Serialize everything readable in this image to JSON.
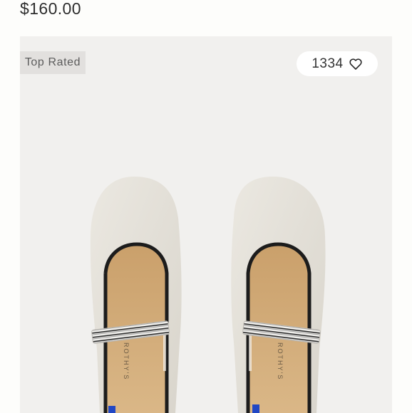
{
  "product": {
    "price": "$160.00"
  },
  "card": {
    "badge": "Top Rated",
    "favorites": {
      "count": "1334",
      "icon": "heart-icon"
    },
    "image": {
      "subject": "pair of white knit Mary Jane flats with black trim and striped strap",
      "insole_brand": "ROTHY'S"
    }
  },
  "colors": {
    "card_background": "#f1f0ee",
    "badge_background": "#e2e0de",
    "shoe_knit": "#e5e2da",
    "insole": "#d4ad78",
    "trim": "#1c1c1c"
  }
}
